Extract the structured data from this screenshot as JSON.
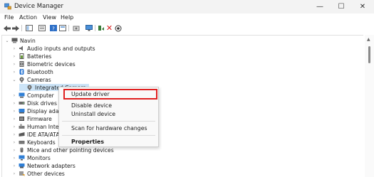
{
  "window": {
    "title": "Device Manager",
    "controls": {
      "minimize": "—",
      "maximize": "☐",
      "close": "✕"
    }
  },
  "menubar": [
    "File",
    "Action",
    "View",
    "Help"
  ],
  "toolbar": {
    "icons": [
      "back-arrow-icon",
      "forward-arrow-icon",
      "show-hide-tree-icon",
      "properties-icon",
      "help-icon",
      "view-icon",
      "scan-icon",
      "monitor-icon",
      "update-driver-icon",
      "uninstall-icon",
      "enable-device-icon"
    ],
    "uninstall_color": "#d81e1e"
  },
  "tree": {
    "root": "Navin",
    "items": [
      {
        "label": "Audio inputs and outputs",
        "icon": "speaker-icon",
        "color": "#6b6b6b"
      },
      {
        "label": "Batteries",
        "icon": "battery-icon",
        "color": "#6b9d3a"
      },
      {
        "label": "Biometric devices",
        "icon": "fingerprint-icon",
        "color": "#5a5a5a"
      },
      {
        "label": "Bluetooth",
        "icon": "bluetooth-icon",
        "color": "#1f6fd1"
      },
      {
        "label": "Cameras",
        "icon": "camera-icon",
        "color": "#555555"
      },
      {
        "label": "Integrated Camera",
        "icon": "camera-icon",
        "color": "#555555"
      },
      {
        "label": "Computer",
        "icon": "computer-icon",
        "color": "#2f7fd6"
      },
      {
        "label": "Disk drives",
        "icon": "disk-drive-icon",
        "color": "#6b6b6b"
      },
      {
        "label": "Display ada",
        "icon": "display-adapter-icon",
        "color": "#2f7fd6"
      },
      {
        "label": "Firmware",
        "icon": "firmware-icon",
        "color": "#555555"
      },
      {
        "label": "Human Inte",
        "icon": "hid-icon",
        "color": "#7a7a7a"
      },
      {
        "label": "IDE ATA/ATA",
        "icon": "ide-icon",
        "color": "#5a5a5a"
      },
      {
        "label": "Keyboards",
        "icon": "keyboard-icon",
        "color": "#6b6b6b"
      },
      {
        "label": "Mice and other pointing devices",
        "icon": "mouse-icon",
        "color": "#6b6b6b"
      },
      {
        "label": "Monitors",
        "icon": "monitor-icon",
        "color": "#2f7fd6"
      },
      {
        "label": "Network adapters",
        "icon": "network-icon",
        "color": "#2f7fd6"
      },
      {
        "label": "Other devices",
        "icon": "other-devices-icon",
        "color": "#888888"
      }
    ]
  },
  "context_menu": {
    "items": [
      "Update driver",
      "Disable device",
      "Uninstall device",
      "Scan for hardware changes",
      "Properties"
    ],
    "highlight_color": "#e02020"
  }
}
